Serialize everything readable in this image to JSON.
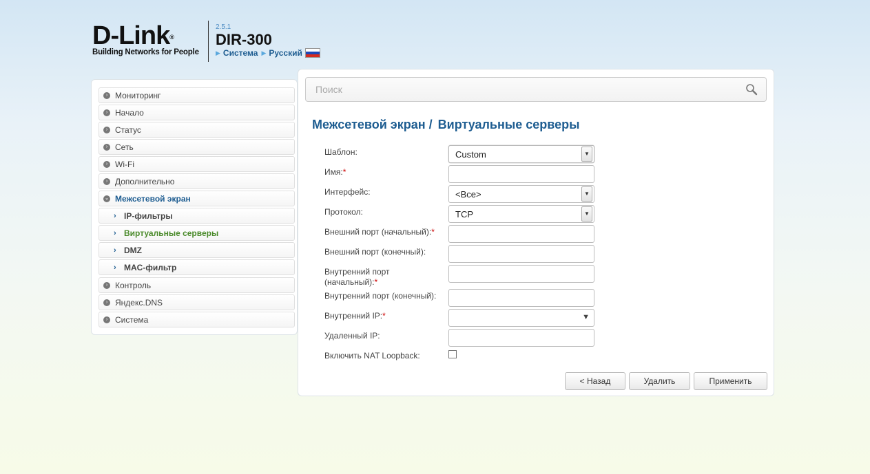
{
  "header": {
    "brand": "D-Link",
    "brand_mark": "®",
    "tagline": "Building Networks for People",
    "firmware_version": "2.5.1",
    "model": "DIR-300",
    "system_link": "Система",
    "language_link": "Русский"
  },
  "sidebar": {
    "items": [
      {
        "label": "Мониторинг"
      },
      {
        "label": "Начало"
      },
      {
        "label": "Статус"
      },
      {
        "label": "Сеть"
      },
      {
        "label": "Wi-Fi"
      },
      {
        "label": "Дополнительно"
      },
      {
        "label": "Межсетевой экран"
      },
      {
        "label": "IP-фильтры"
      },
      {
        "label": "Виртуальные серверы"
      },
      {
        "label": "DMZ"
      },
      {
        "label": "MAC-фильтр"
      },
      {
        "label": "Контроль"
      },
      {
        "label": "Яндекс.DNS"
      },
      {
        "label": "Система"
      }
    ]
  },
  "search": {
    "placeholder": "Поиск"
  },
  "page": {
    "breadcrumb_parent": "Межсетевой экран /",
    "breadcrumb_current": "Виртуальные серверы"
  },
  "form": {
    "template_label": "Шаблон:",
    "template_value": "Custom",
    "name_label": "Имя:",
    "name_value": "",
    "interface_label": "Интерфейс:",
    "interface_value": "<Все>",
    "protocol_label": "Протокол:",
    "protocol_value": "TCP",
    "ext_port_start_label": "Внешний порт (начальный):",
    "ext_port_start_value": "",
    "ext_port_end_label": "Внешний порт (конечный):",
    "ext_port_end_value": "",
    "int_port_start_label_1": "Внутренний порт",
    "int_port_start_label_2": "(начальный):",
    "int_port_start_value": "",
    "int_port_end_label": "Внутренний порт (конечный):",
    "int_port_end_value": "",
    "int_ip_label": "Внутренний IP:",
    "int_ip_value": "",
    "remote_ip_label": "Удаленный IP:",
    "remote_ip_value": "",
    "nat_loopback_label": "Включить NAT Loopback:",
    "nat_loopback_checked": false,
    "required_mark": "*"
  },
  "actions": {
    "back": "< Назад",
    "delete": "Удалить",
    "apply": "Применить"
  }
}
